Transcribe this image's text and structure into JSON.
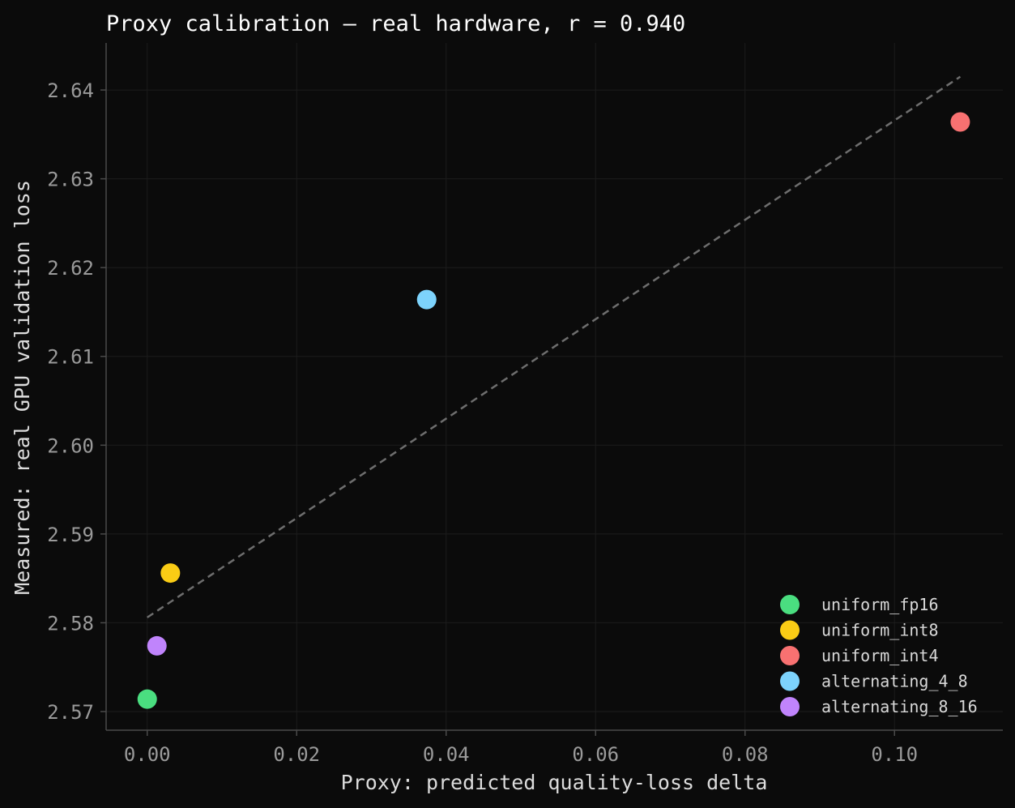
{
  "chart_data": {
    "type": "scatter",
    "title": "Proxy calibration — real hardware, r = 0.940",
    "xlabel": "Proxy: predicted quality-loss delta",
    "ylabel": "Measured: real GPU validation loss",
    "xlim": [
      -0.0055,
      0.1145
    ],
    "ylim": [
      2.5679,
      2.6453
    ],
    "x_ticks": [
      0.0,
      0.02,
      0.04,
      0.06,
      0.08,
      0.1
    ],
    "x_tick_labels": [
      "0.00",
      "0.02",
      "0.04",
      "0.06",
      "0.08",
      "0.10"
    ],
    "y_ticks": [
      2.57,
      2.58,
      2.59,
      2.6,
      2.61,
      2.62,
      2.63,
      2.64
    ],
    "y_tick_labels": [
      "2.57",
      "2.58",
      "2.59",
      "2.60",
      "2.61",
      "2.62",
      "2.63",
      "2.64"
    ],
    "grid": true,
    "legend_position": "bottom-right",
    "series": [
      {
        "name": "uniform_fp16",
        "color": "#4ade80",
        "x": [
          0.0
        ],
        "y": [
          2.5714
        ]
      },
      {
        "name": "uniform_int8",
        "color": "#facc15",
        "x": [
          0.0031
        ],
        "y": [
          2.5856
        ]
      },
      {
        "name": "uniform_int4",
        "color": "#f87171",
        "x": [
          0.1088
        ],
        "y": [
          2.6364
        ]
      },
      {
        "name": "alternating_4_8",
        "color": "#7dd3fc",
        "x": [
          0.0374
        ],
        "y": [
          2.6164
        ]
      },
      {
        "name": "alternating_8_16",
        "color": "#c084fc",
        "x": [
          0.0013
        ],
        "y": [
          2.5774
        ]
      }
    ],
    "fit_line": {
      "style": "dashed",
      "color": "#6e6e6e",
      "x": [
        0.0,
        0.1088
      ],
      "y": [
        2.5806,
        2.6415
      ]
    },
    "colors": {
      "background": "#0b0b0b",
      "grid": "#1c1c1c",
      "axis": "#4a4a4a",
      "tick": "#9a9a9a"
    }
  }
}
